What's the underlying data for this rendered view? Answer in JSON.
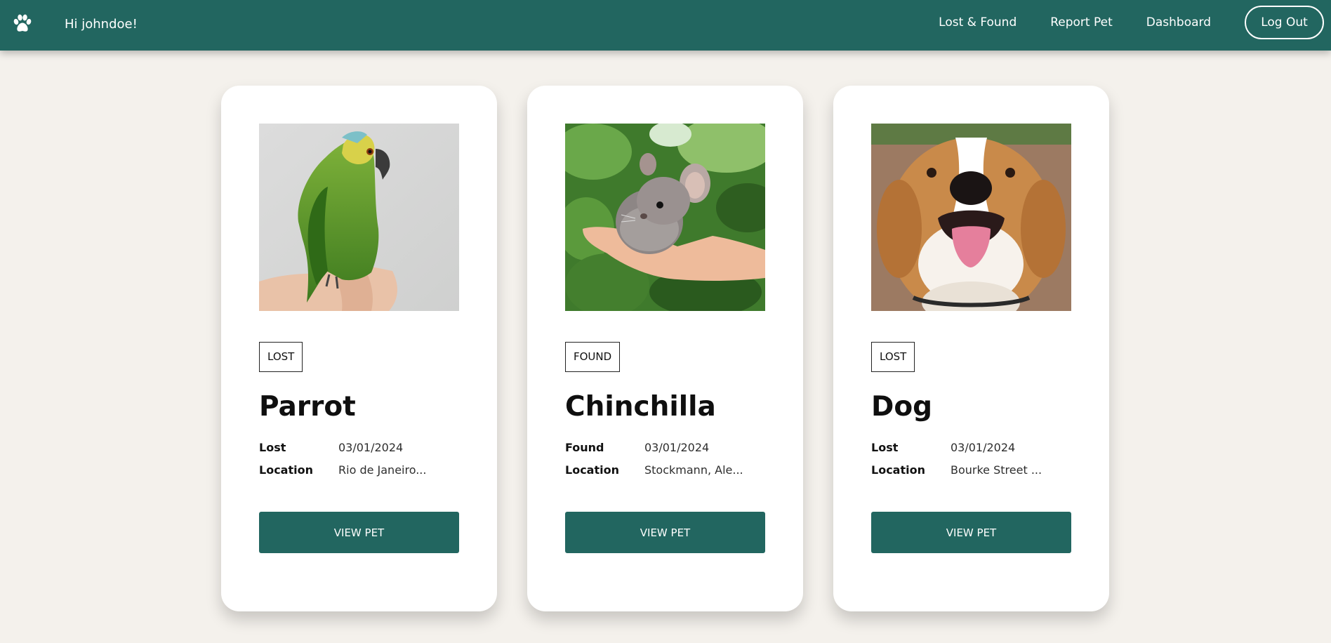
{
  "header": {
    "logo_icon": "paw-icon",
    "greeting": "Hi johndoe!",
    "nav": {
      "lost_found": "Lost & Found",
      "report_pet": "Report Pet",
      "dashboard": "Dashboard",
      "logout": "Log Out"
    }
  },
  "colors": {
    "primary": "#226660",
    "background": "#f4f1ec",
    "card": "#ffffff"
  },
  "pets": [
    {
      "photo": "parrot-photo",
      "status": "LOST",
      "name": "Parrot",
      "date_label": "Lost",
      "date": "03/01/2024",
      "location_label": "Location",
      "location": "Rio de Janeiro...",
      "button": "VIEW PET"
    },
    {
      "photo": "chinchilla-photo",
      "status": "FOUND",
      "name": "Chinchilla",
      "date_label": "Found",
      "date": "03/01/2024",
      "location_label": "Location",
      "location": "Stockmann, Ale...",
      "button": "VIEW PET"
    },
    {
      "photo": "beagle-photo",
      "status": "LOST",
      "name": "Dog",
      "date_label": "Lost",
      "date": "03/01/2024",
      "location_label": "Location",
      "location": "Bourke Street ...",
      "button": "VIEW PET"
    }
  ]
}
